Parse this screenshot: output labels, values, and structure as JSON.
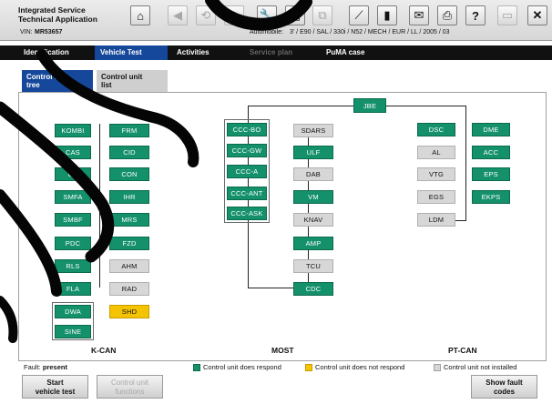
{
  "header": {
    "app_title_line1": "Integrated Service",
    "app_title_line2": "Technical Application",
    "vin_label": "VIN:",
    "vin_value": "MR53657",
    "automobile_label": "Automobile:",
    "automobile_value": "3' / E90 / SAL / 330i / N52 / MECH / EUR / LL / 2005 / 03"
  },
  "nav_tabs": [
    "Identification",
    "Vehicle Test",
    "Activities",
    "Service plan",
    "PuMA case"
  ],
  "sub_tabs": {
    "tree_line1": "Control unit",
    "tree_line2": "tree",
    "list_line1": "Control unit",
    "list_line2": "list"
  },
  "nodes": {
    "kcan_left": [
      "KOMBI",
      "CAS",
      "CA",
      "SMFA",
      "SMBF",
      "PDC",
      "RLS",
      "FLA",
      "DWA",
      "SINE"
    ],
    "kcan_right": [
      "FRM",
      "CID",
      "CON",
      "IHR",
      "MRS",
      "FZD",
      "AHM",
      "RAD",
      "SHD"
    ],
    "most_group": [
      "CCC-BO",
      "CCC-GW",
      "CCC-A",
      "CCC-ANT",
      "CCC-ASK"
    ],
    "most_right": [
      "SDARS",
      "ULF",
      "DAB",
      "VM",
      "KNAV",
      "AMP",
      "TCU",
      "CDC"
    ],
    "jbe": "JBE",
    "ptcan_left": [
      "DSC",
      "AL",
      "VTG",
      "EGS",
      "LDM"
    ],
    "ptcan_right": [
      "DME",
      "ACC",
      "EPS",
      "EKPS"
    ]
  },
  "buses": {
    "kcan": "K-CAN",
    "most": "MOST",
    "ptcan": "PT-CAN"
  },
  "status": {
    "fault_label": "Fault:",
    "fault_value": "present"
  },
  "legend": {
    "respond": "Control unit does respond",
    "not_respond": "Control unit does not respond",
    "not_installed": "Control unit not installed",
    "colors": {
      "respond": "#14906a",
      "not_respond": "#f5c400",
      "not_installed": "#d7d7d7"
    }
  },
  "buttons": {
    "start_line1": "Start",
    "start_line2": "vehicle test",
    "functions_line1": "Control unit",
    "functions_line2": "functions",
    "show_line1": "Show fault",
    "show_line2": "codes"
  },
  "colors": {
    "nav_active": "#15489a",
    "node_green": "#14906a",
    "node_grey": "#d7d7d7",
    "node_yellow": "#f5c400"
  }
}
